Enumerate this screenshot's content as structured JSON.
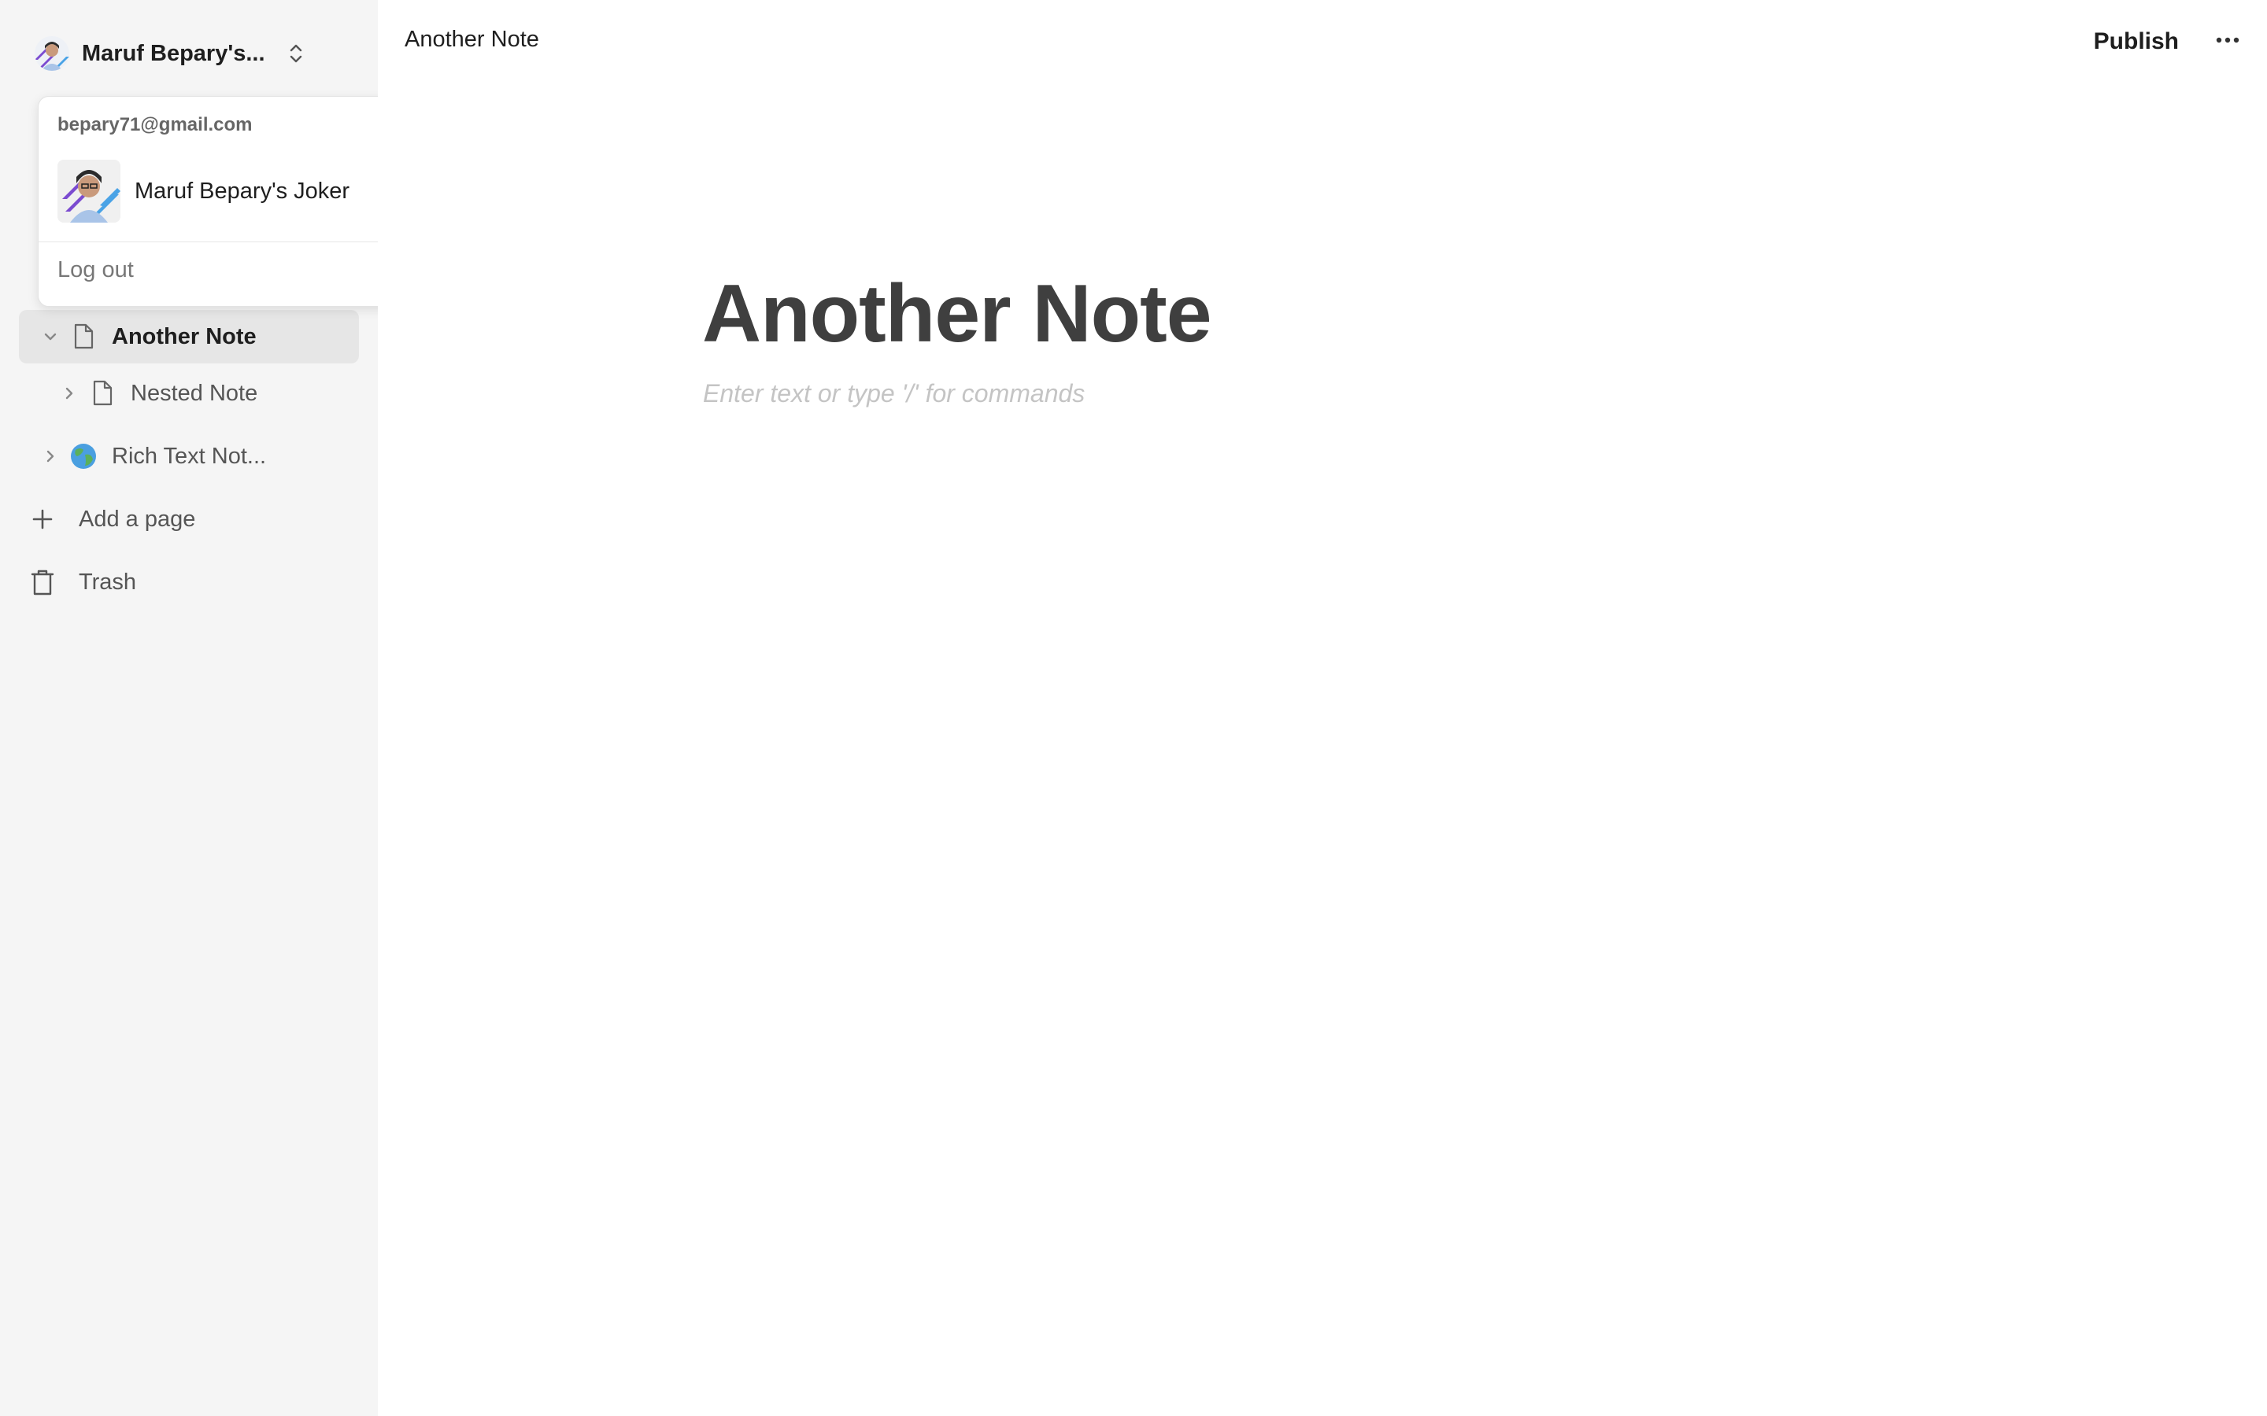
{
  "sidebar": {
    "workspace_name": "Maruf Bepary's...",
    "tree": [
      {
        "label": "Another Note",
        "icon": "file-icon",
        "expanded": true,
        "active": true
      },
      {
        "label": "Nested Note",
        "icon": "file-icon",
        "expanded": false,
        "active": false
      },
      {
        "label": "Rich Text Not...",
        "icon": "globe-emoji-icon",
        "expanded": false,
        "active": false
      }
    ],
    "add_page_label": "Add a page",
    "trash_label": "Trash"
  },
  "account_menu": {
    "email": "bepary71@gmail.com",
    "account_name": "Maruf Bepary's Joker",
    "logout_label": "Log out"
  },
  "topbar": {
    "breadcrumb": "Another Note",
    "publish_label": "Publish",
    "more_icon": "more-horizontal-icon"
  },
  "editor": {
    "title": "Another Note",
    "placeholder": "Enter text or type '/' for commands"
  },
  "colors": {
    "sidebar_bg": "#f5f5f5",
    "active_item_bg": "#e6e6e6",
    "title_color": "#3f3f3f",
    "placeholder_color": "#c4c4c4"
  }
}
